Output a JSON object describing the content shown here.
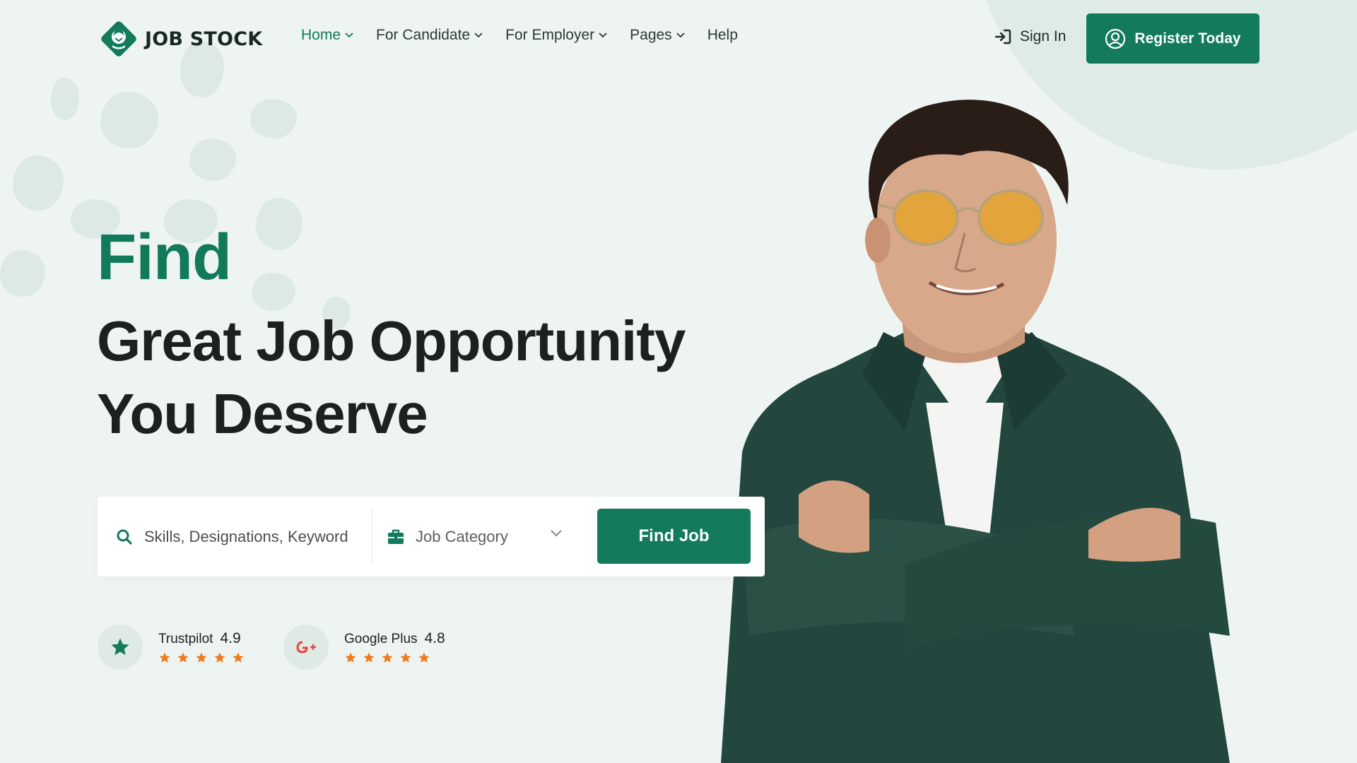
{
  "brand": {
    "name": "JOB STOCK"
  },
  "nav": {
    "items": [
      {
        "label": "Home",
        "active": true,
        "dropdown": true
      },
      {
        "label": "For Candidate",
        "active": false,
        "dropdown": true
      },
      {
        "label": "For Employer",
        "active": false,
        "dropdown": true
      },
      {
        "label": "Pages",
        "active": false,
        "dropdown": true
      },
      {
        "label": "Help",
        "active": false,
        "dropdown": false
      }
    ]
  },
  "header": {
    "signin_label": "Sign In",
    "register_label": "Register Today"
  },
  "hero": {
    "find": "Find",
    "line1": "Great Job Opportunity",
    "line2": "You Deserve"
  },
  "search": {
    "keyword_placeholder": "Skills, Designations, Keyword",
    "category_label": "Job Category",
    "button_label": "Find Job"
  },
  "ratings": [
    {
      "name": "Trustpilot",
      "score": "4.9",
      "icon": "star-icon",
      "stars": 5
    },
    {
      "name": "Google Plus",
      "score": "4.8",
      "icon": "google-plus-icon",
      "stars": 5
    }
  ],
  "colors": {
    "accent": "#137a5c",
    "background": "#eef4f1",
    "star": "#f07b1c",
    "google": "#e8453c"
  }
}
